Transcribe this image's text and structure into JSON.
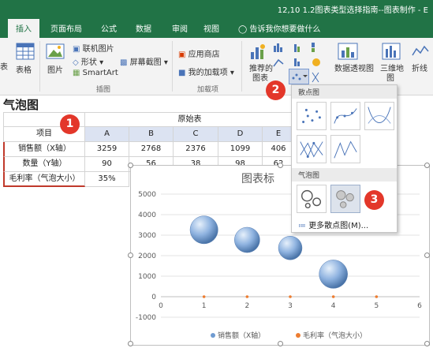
{
  "window": {
    "doc_title": "12,10 1.2图表类型选择指南--图表制作 - E"
  },
  "tabs": [
    {
      "label": "插入",
      "active": true
    },
    {
      "label": "页面布局"
    },
    {
      "label": "公式"
    },
    {
      "label": "数据"
    },
    {
      "label": "审阅"
    },
    {
      "label": "视图"
    }
  ],
  "tellme": "告诉我你想要做什么",
  "ribbon": {
    "tables_label": "表格",
    "table_side": "表",
    "pictures_label": "图片",
    "online_pictures": "联机图片",
    "shapes": "形状",
    "screenshot": "屏幕截图",
    "smartart": "SmartArt",
    "illustrations_group": "插图",
    "store": "应用商店",
    "my_addins": "我的加载项",
    "addins_group": "加载项",
    "recommended_charts_line1": "推荐的",
    "recommended_charts_line2": "图表",
    "pivot_chart": "数据透视图",
    "map3d_line1": "三维地",
    "map3d_line2": "图",
    "sparkline": "折线"
  },
  "sheet": {
    "title": "气泡图",
    "table_caption": "原始表",
    "columns": [
      "项目",
      "A",
      "B",
      "C",
      "D",
      "E"
    ],
    "rows": [
      {
        "label": "销售额（X轴）",
        "values": [
          "3259",
          "2768",
          "2376",
          "1099",
          "406"
        ]
      },
      {
        "label": "数量（Y轴）",
        "values": [
          "90",
          "56",
          "38",
          "98",
          "62"
        ]
      },
      {
        "label": "毛利率（气泡大小）",
        "values": [
          "35%"
        ]
      }
    ]
  },
  "dropdown": {
    "scatter_header": "散点图",
    "bubble_header": "气泡图",
    "more": "更多散点图(M)..."
  },
  "chart_data": {
    "type": "scatter",
    "title": "图表标",
    "ylim": [
      0,
      5000
    ],
    "xlim": [
      0,
      6
    ],
    "y_ticks": [
      "5000",
      "4000",
      "3000",
      "2000",
      "1000",
      "0",
      "-1000"
    ],
    "x_ticks": [
      "0",
      "1",
      "2",
      "3",
      "4",
      "5",
      "6"
    ],
    "series": [
      {
        "name": "销售额（X轴）",
        "points": [
          {
            "x": 1,
            "y": 3259,
            "size": 90
          },
          {
            "x": 2,
            "y": 2768,
            "size": 56
          },
          {
            "x": 3,
            "y": 2376,
            "size": 38
          },
          {
            "x": 4,
            "y": 1099,
            "size": 98
          }
        ],
        "color": "#6f9bd1"
      },
      {
        "name": "毛利率（气泡大小）",
        "points": [
          {
            "x": 1,
            "y": 0
          },
          {
            "x": 2,
            "y": 0
          },
          {
            "x": 3,
            "y": 0
          },
          {
            "x": 4,
            "y": 0
          },
          {
            "x": 5,
            "y": 0
          }
        ],
        "color": "#ed7d31"
      }
    ],
    "legend_position": "bottom"
  },
  "callouts": [
    "1",
    "2",
    "3"
  ]
}
